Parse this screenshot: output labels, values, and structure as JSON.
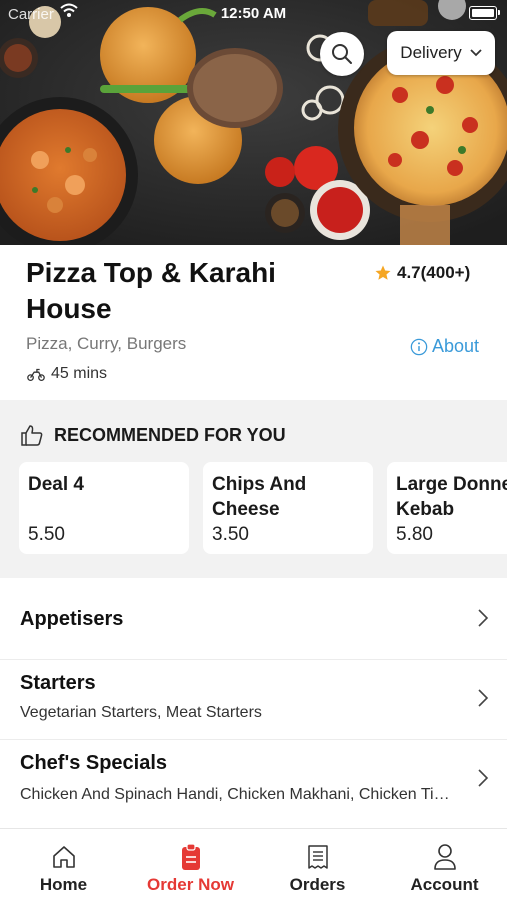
{
  "status_bar": {
    "carrier": "Carrier",
    "time": "12:50 AM"
  },
  "header": {
    "delivery_label": "Delivery"
  },
  "restaurant": {
    "name": "Pizza Top & Karahi House",
    "rating": "4.7(400+)",
    "cuisines": "Pizza, Curry, Burgers",
    "eta": "45 mins",
    "about_label": "About"
  },
  "recommended": {
    "title": "RECOMMENDED FOR YOU",
    "items": [
      {
        "name_line1": "Deal 4",
        "name_line2": "",
        "price": "5.50"
      },
      {
        "name_line1": "Chips And",
        "name_line2": "Cheese",
        "price": "3.50"
      },
      {
        "name_line1": "Large Donner",
        "name_line2": "Kebab",
        "price": "5.80"
      }
    ]
  },
  "categories": [
    {
      "title": "Appetisers",
      "subtitle": ""
    },
    {
      "title": "Starters",
      "subtitle": "Vegetarian Starters, Meat Starters"
    },
    {
      "title": "Chef's Specials",
      "subtitle": "Chicken And Spinach Handi, Chicken Makhani, Chicken Tikka Masala"
    }
  ],
  "tabs": [
    {
      "label": "Home",
      "icon": "home-icon"
    },
    {
      "label": "Order Now",
      "icon": "order-icon"
    },
    {
      "label": "Orders",
      "icon": "receipt-icon"
    },
    {
      "label": "Account",
      "icon": "person-icon"
    }
  ],
  "colors": {
    "accent_red": "#e53935",
    "link_blue": "#3a9ad9",
    "star_gold": "#f5a623"
  }
}
